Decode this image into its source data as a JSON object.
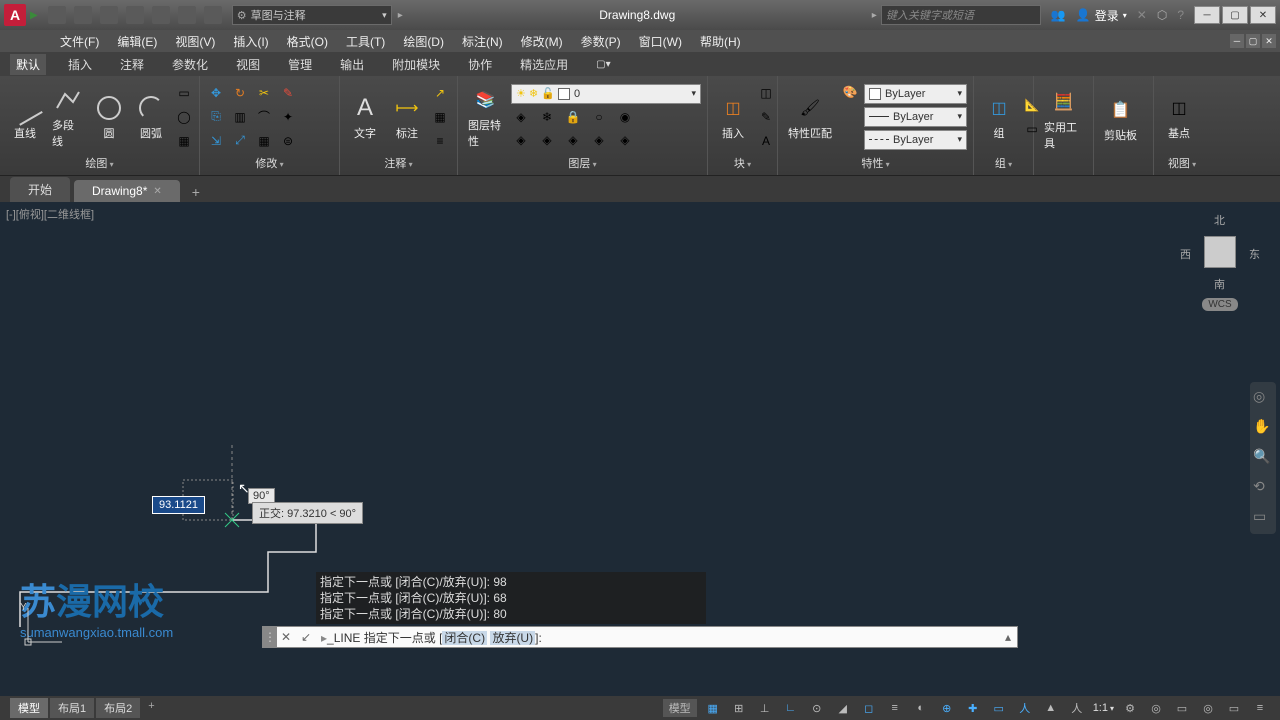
{
  "title": "Drawing8.dwg",
  "qat_dropdown": "草图与注释",
  "search_placeholder": "键入关键字或短语",
  "login": "登录",
  "menu": {
    "file": "文件(F)",
    "edit": "编辑(E)",
    "view": "视图(V)",
    "insert": "插入(I)",
    "format": "格式(O)",
    "tools": "工具(T)",
    "draw": "绘图(D)",
    "dimension": "标注(N)",
    "modify": "修改(M)",
    "params": "参数(P)",
    "window": "窗口(W)",
    "help": "帮助(H)"
  },
  "ribtabs": {
    "default": "默认",
    "insert": "插入",
    "annotate": "注释",
    "parametric": "参数化",
    "view": "视图",
    "manage": "管理",
    "output": "输出",
    "addins": "附加模块",
    "collab": "协作",
    "featured": "精选应用"
  },
  "panels": {
    "draw": {
      "title": "绘图",
      "line": "直线",
      "polyline": "多段线",
      "circle": "圆",
      "arc": "圆弧"
    },
    "modify": {
      "title": "修改"
    },
    "annot": {
      "title": "注释",
      "text": "文字",
      "dim": "标注"
    },
    "layer": {
      "title": "图层",
      "props": "图层特性",
      "current": "0"
    },
    "block": {
      "title": "块",
      "insert": "插入"
    },
    "props": {
      "title": "特性",
      "match": "特性匹配",
      "bylayer": "ByLayer"
    },
    "group": {
      "title": "组",
      "label": "组"
    },
    "util": {
      "title": "实用工具"
    },
    "clip": {
      "title": "剪贴板"
    },
    "vw": {
      "title": "视图",
      "label": "基点"
    }
  },
  "filetabs": {
    "start": "开始",
    "active": "Drawing8*"
  },
  "viewport_label": "[-][俯视][二维线框]",
  "compass": {
    "n": "北",
    "s": "南",
    "e": "东",
    "w": "西",
    "wcs": "WCS"
  },
  "drawing": {
    "dim_input": "93.1121",
    "angle": "90°",
    "tooltip_label": "正交:",
    "tooltip_val": "97.3210 < 90°"
  },
  "watermark": {
    "c1": "苏",
    "c2": "漫",
    "c3": "网",
    "c4": "校",
    "url": "sumanwangxiao.tmall.com"
  },
  "history": {
    "l1": "指定下一点或 [闭合(C)/放弃(U)]: 98",
    "l2": "指定下一点或 [闭合(C)/放弃(U)]: 68",
    "l3": "指定下一点或 [闭合(C)/放弃(U)]: 80"
  },
  "cmdline": {
    "cmd": "LINE",
    "prompt": "指定下一点或 [",
    "opt1": "闭合(C)",
    "opt2": "放弃(U)",
    "close": "]:"
  },
  "status": {
    "model": "模型",
    "layout1": "布局1",
    "layout2": "布局2",
    "model_r": "模型",
    "scale": "1:1"
  }
}
